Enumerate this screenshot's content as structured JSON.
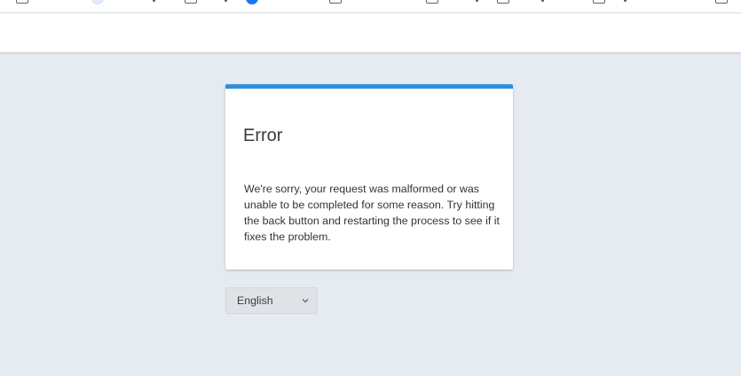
{
  "bookmarks_bar": {
    "items": [
      {
        "icon": "folder-icon"
      },
      {
        "icon": "profile-icon"
      },
      {
        "icon": "folder-icon"
      },
      {
        "icon": "facebook-icon"
      },
      {
        "icon": "folder-icon"
      },
      {
        "icon": "folder-icon"
      },
      {
        "icon": "folder-icon"
      },
      {
        "icon": "folder-icon"
      },
      {
        "icon": "folder-icon"
      }
    ]
  },
  "error_card": {
    "title": "Error",
    "message": "We're sorry, your request was malformed or was unable to be completed for some reason. Try hitting the back button and restarting the process to see if it fixes the problem.",
    "accent_color": "#2f8fdd"
  },
  "language_select": {
    "selected": "English",
    "icon": "chevron-down-icon"
  },
  "colors": {
    "page_background": "#e6eaf1",
    "header_background": "#ffffff",
    "card_background": "#ffffff"
  }
}
